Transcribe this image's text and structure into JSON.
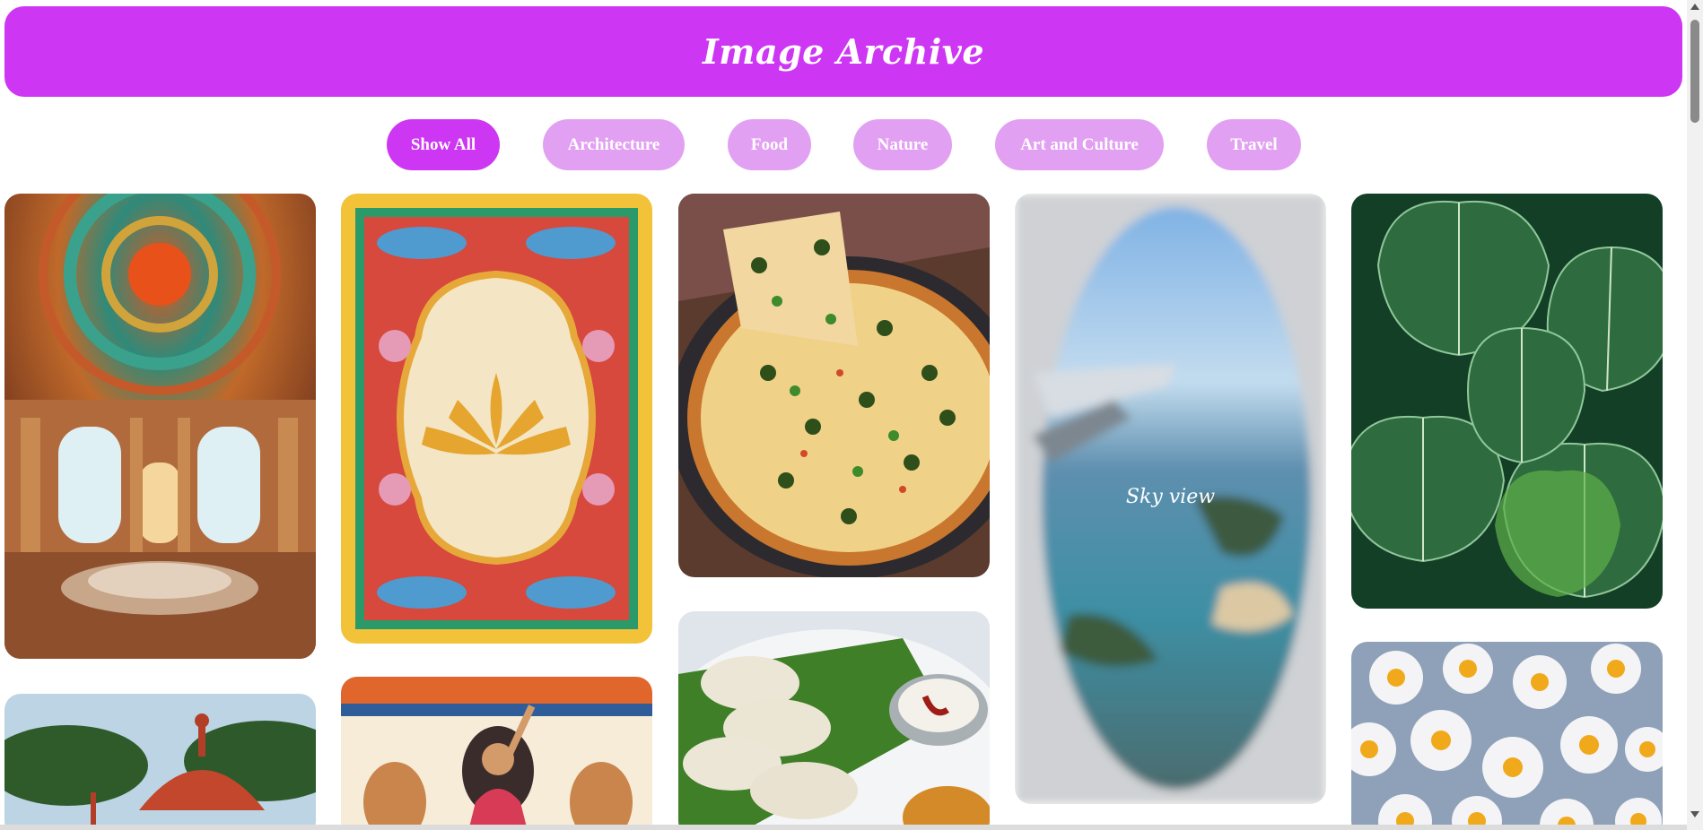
{
  "header": {
    "title": "Image Archive"
  },
  "filters": [
    {
      "label": "Show All",
      "active": true
    },
    {
      "label": "Architecture",
      "active": false
    },
    {
      "label": "Food",
      "active": false
    },
    {
      "label": "Nature",
      "active": false
    },
    {
      "label": "Art and Culture",
      "active": false
    },
    {
      "label": "Travel",
      "active": false
    }
  ],
  "gallery": {
    "sky_view_caption": "Sky view"
  },
  "colors": {
    "accent": "#cd37f3",
    "accent_light": "#e2a0f2"
  }
}
